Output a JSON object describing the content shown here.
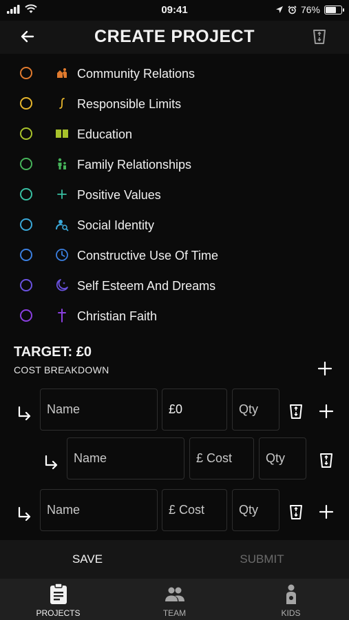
{
  "status": {
    "time": "09:41",
    "battery": "76%",
    "battery_level": 0.76
  },
  "header": {
    "title": "CREATE PROJECT"
  },
  "assets": [
    {
      "label": "Community Relations",
      "color": "#e07a2e",
      "icon": "community-icon"
    },
    {
      "label": "Responsible Limits",
      "color": "#e6b52c",
      "icon": "limits-icon"
    },
    {
      "label": "Education",
      "color": "#a8c22b",
      "icon": "book-icon"
    },
    {
      "label": "Family Relationships",
      "color": "#46b35a",
      "icon": "family-icon"
    },
    {
      "label": "Positive Values",
      "color": "#38bfa2",
      "icon": "plus-icon"
    },
    {
      "label": "Social Identity",
      "color": "#3aa8d9",
      "icon": "identity-icon"
    },
    {
      "label": "Constructive Use Of Time",
      "color": "#3b7fe0",
      "icon": "clock-icon"
    },
    {
      "label": "Self Esteem And Dreams",
      "color": "#6a52e0",
      "icon": "moon-icon"
    },
    {
      "label": "Christian Faith",
      "color": "#8a3fe0",
      "icon": "cross-icon"
    }
  ],
  "budget": {
    "target": "TARGET: £0",
    "cost_breakdown": "COST BREAKDOWN"
  },
  "cost_rows": [
    {
      "name": "Name",
      "cost": "£0",
      "qty": "Qty"
    },
    {
      "name": "Name",
      "cost": "£ Cost",
      "qty": "Qty"
    },
    {
      "name": "Name",
      "cost": "£ Cost",
      "qty": "Qty"
    }
  ],
  "actions": {
    "save": "SAVE",
    "submit": "SUBMIT"
  },
  "tabs": [
    {
      "label": "PROJECTS",
      "icon": "clipboard-icon"
    },
    {
      "label": "TEAM",
      "icon": "team-icon"
    },
    {
      "label": "KIDS",
      "icon": "kid-icon"
    }
  ]
}
